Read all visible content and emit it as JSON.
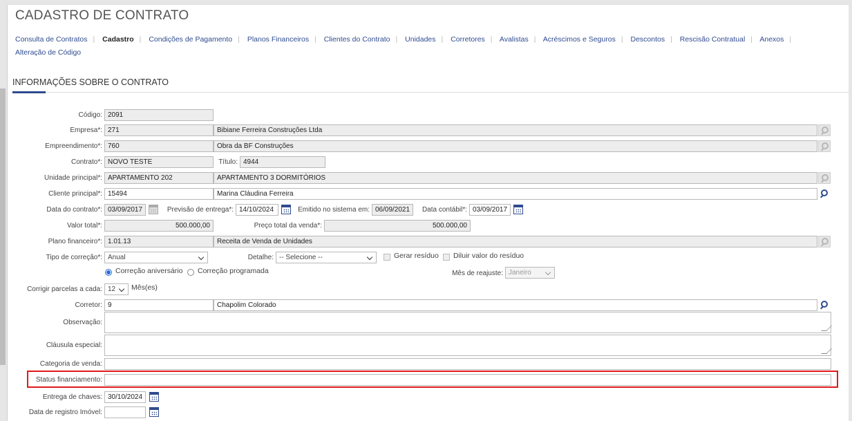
{
  "header": {
    "title": "CADASTRO DE CONTRATO"
  },
  "nav": {
    "items": [
      "Consulta de Contratos",
      "Cadastro",
      "Condições de Pagamento",
      "Planos Financeiros",
      "Clientes do Contrato",
      "Unidades",
      "Corretores",
      "Avalistas",
      "Acréscimos e Seguros",
      "Descontos",
      "Rescisão Contratual",
      "Anexos",
      "Alteração de Código"
    ],
    "active": "Cadastro"
  },
  "section": {
    "title": "INFORMAÇÕES SOBRE O CONTRATO"
  },
  "form": {
    "codigo": {
      "label": "Código:",
      "value": "2091"
    },
    "empresa": {
      "label": "Empresa*:",
      "code": "271",
      "name": "Bibiane Ferreira Construções Ltda"
    },
    "empreendimento": {
      "label": "Empreendimento*:",
      "code": "760",
      "name": "Obra da BF Construções"
    },
    "contrato": {
      "label": "Contrato*:",
      "value": "NOVO TESTE"
    },
    "titulo": {
      "label": "Título:",
      "value": "4944"
    },
    "unidade": {
      "label": "Unidade principal*:",
      "code": "APARTAMENTO 202",
      "name": "APARTAMENTO 3 DORMITÓRIOS"
    },
    "cliente": {
      "label": "Cliente principal*:",
      "code": "15494",
      "name": "Marina Cláudina Ferreira"
    },
    "data_contrato": {
      "label": "Data do contrato*:",
      "value": "03/09/2017"
    },
    "previsao_entrega": {
      "label": "Previsão de entrega*:",
      "value": "14/10/2024"
    },
    "emitido_sistema": {
      "label": "Emitido no sistema em:",
      "value": "06/09/2021"
    },
    "data_contabil": {
      "label": "Data contábil*:",
      "value": "03/09/2017"
    },
    "valor_total": {
      "label": "Valor total*:",
      "value": "500.000,00"
    },
    "preco_total": {
      "label": "Preço total da venda*:",
      "value": "500.000,00"
    },
    "plano_financeiro": {
      "label": "Plano financeiro*:",
      "code": "1.01.13",
      "name": "Receita de Venda de Unidades"
    },
    "tipo_correcao": {
      "label": "Tipo de correção*:",
      "value": "Anual"
    },
    "detalhe": {
      "label": "Detalhe:",
      "value": "-- Selecione --"
    },
    "gerar_residuo": {
      "label": "Gerar resíduo"
    },
    "diluir_residuo": {
      "label": "Diluir valor do resíduo"
    },
    "correcao_aniversario": {
      "label": "Correção aniversário"
    },
    "correcao_programada": {
      "label": "Correção programada"
    },
    "mes_reajuste": {
      "label": "Mês de reajuste:",
      "value": "Janeiro"
    },
    "corrigir_parcelas": {
      "label": "Corrigir parcelas a cada:",
      "value": "12",
      "unit": "Mês(es)"
    },
    "corretor": {
      "label": "Corretor:",
      "code": "9",
      "name": "Chapolim Colorado"
    },
    "observacao": {
      "label": "Observação:",
      "value": ""
    },
    "clausula_especial": {
      "label": "Cláusula especial:",
      "value": ""
    },
    "categoria_venda": {
      "label": "Categoria de venda:",
      "value": ""
    },
    "status_financiamento": {
      "label": "Status financiamento:",
      "value": ""
    },
    "entrega_chaves": {
      "label": "Entrega de chaves:",
      "value": "30/10/2024"
    },
    "data_registro": {
      "label": "Data de registro Imóvel:",
      "value": ""
    }
  },
  "colors": {
    "accent": "#2f4b8f",
    "highlight": "#e01919",
    "radio": "#2a6fd6"
  }
}
